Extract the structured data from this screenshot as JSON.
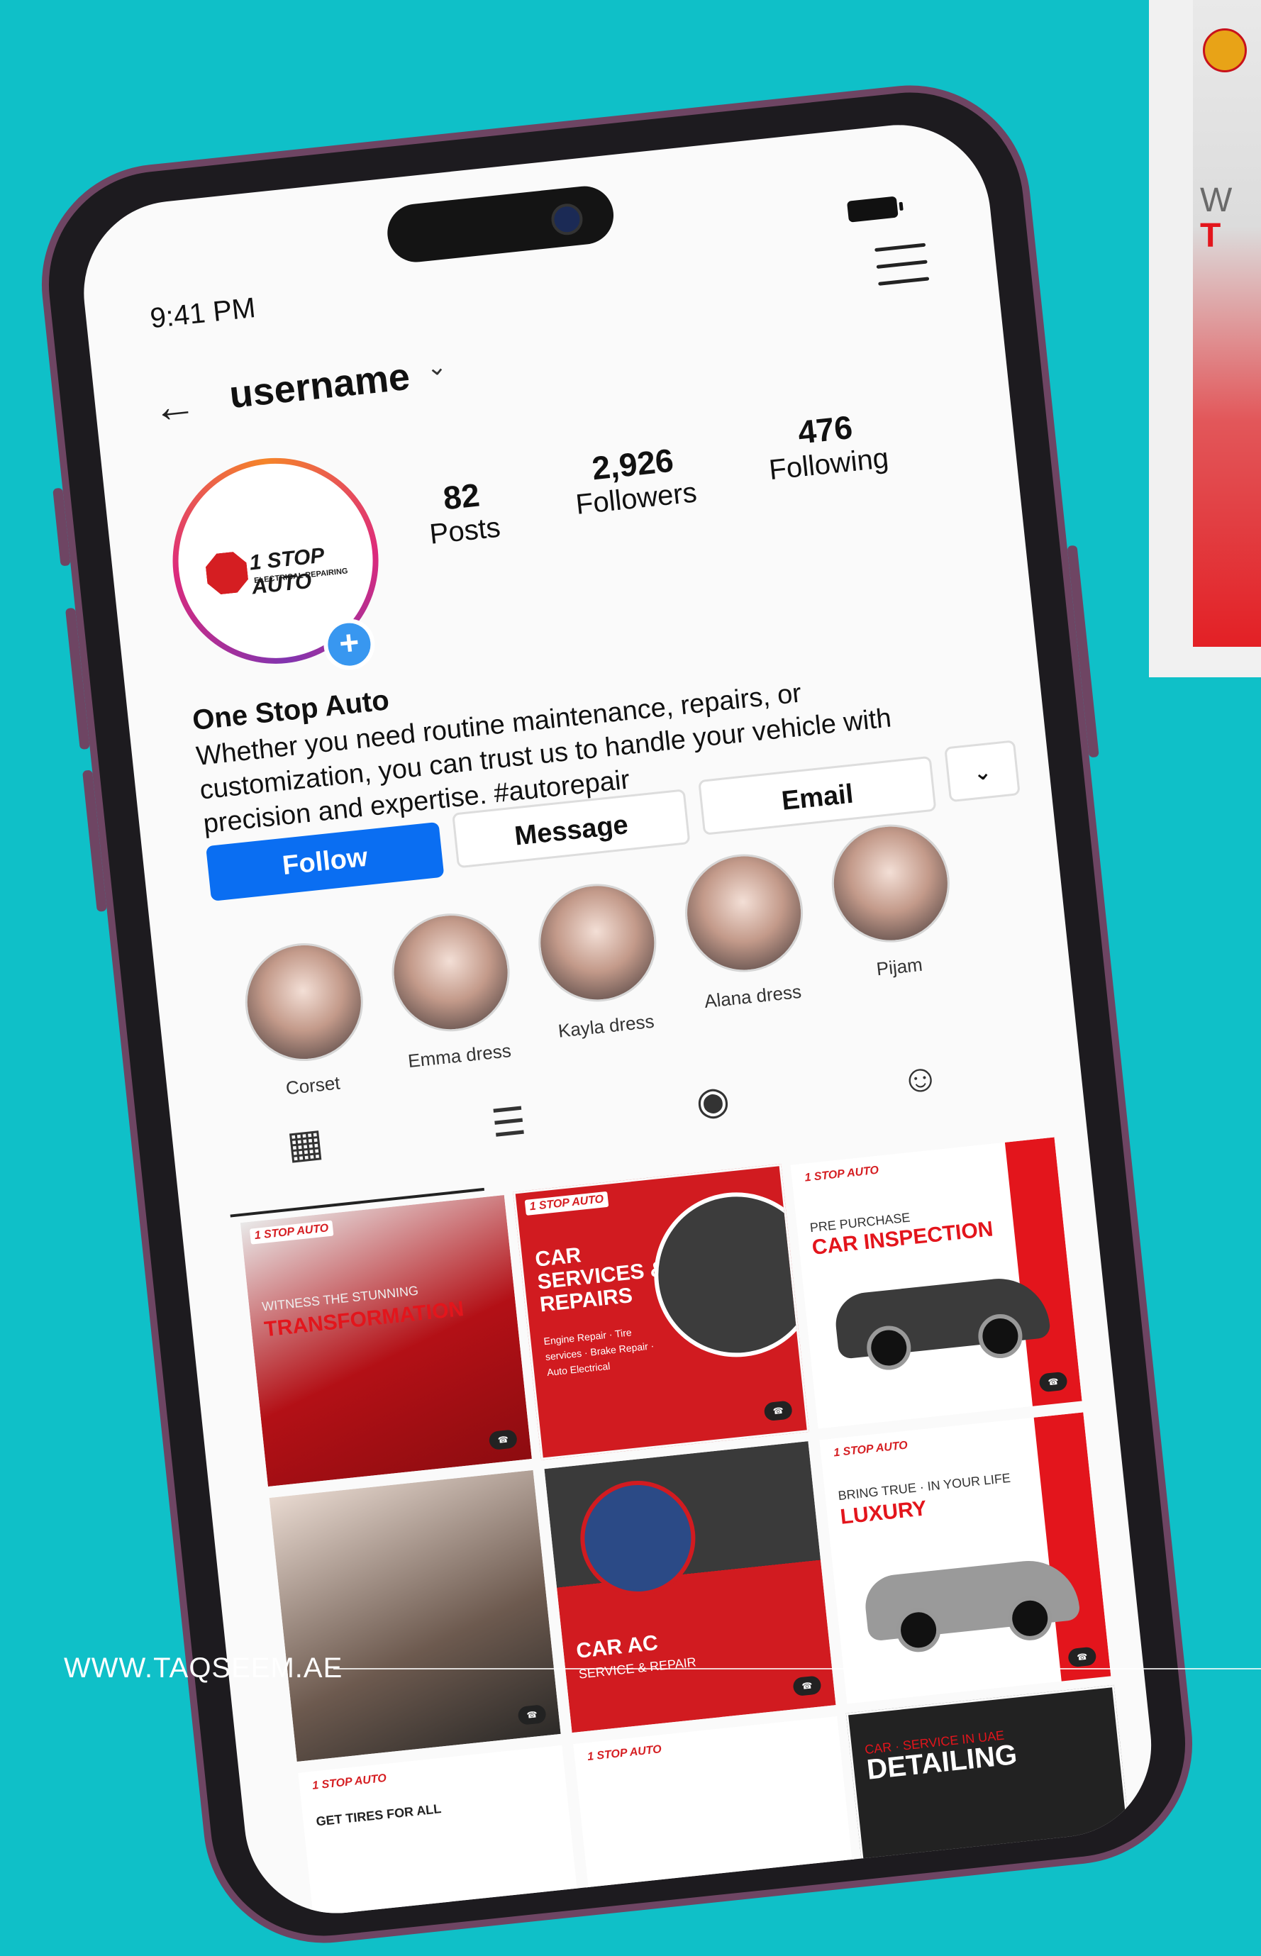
{
  "status": {
    "time": "9:41 PM"
  },
  "profile": {
    "username": "username",
    "stats": [
      {
        "value": "82",
        "label": "Posts"
      },
      {
        "value": "2,926",
        "label": "Followers"
      },
      {
        "value": "476",
        "label": "Following"
      }
    ],
    "name": "One Stop Auto",
    "bio": "Whether you need routine maintenance, repairs, or customization,  you can trust us to handle your vehicle with precision and expertise. #autorepair",
    "logo": {
      "main": "1 STOP AUTO",
      "sub": "ELECTRICAL REPAIRING"
    }
  },
  "actions": {
    "follow": "Follow",
    "message": "Message",
    "email": "Email"
  },
  "highlights": [
    {
      "label": "Corset"
    },
    {
      "label": "Emma dress"
    },
    {
      "label": "Kayla dress"
    },
    {
      "label": "Alana dress"
    },
    {
      "label": "Pijam"
    }
  ],
  "tabs": [
    "grid-icon",
    "list-icon",
    "location-pin-icon",
    "tagged-user-icon"
  ],
  "posts": [
    {
      "title": "TRANSFORMATION",
      "subtitle": "WITNESS THE STUNNING",
      "bg": "#c8161c"
    },
    {
      "title": "CAR SERVICES & REPAIRS",
      "subtitle": "Engine Repair · Tire services · Brake Repair · Auto Electrical",
      "bg": "#d11b20"
    },
    {
      "title": "CAR INSPECTION",
      "subtitle": "PRE PURCHASE",
      "bg": "#ffffff"
    },
    {
      "title": "",
      "subtitle": "",
      "bg": "#4a3a34"
    },
    {
      "title": "CAR AC",
      "subtitle": "SERVICE & REPAIR",
      "bg": "#d11b20"
    },
    {
      "title": "LUXURY",
      "subtitle": "BRING TRUE · IN YOUR LIFE",
      "bg": "#ffffff"
    },
    {
      "title": "GET TIRES FOR ALL",
      "subtitle": "",
      "bg": "#ffffff"
    },
    {
      "title": "",
      "subtitle": "",
      "bg": "#ffffff"
    },
    {
      "title": "DETAILING",
      "subtitle": "CAR · SERVICE IN UAE",
      "bg": "#222222"
    }
  ],
  "promo": {
    "line1": "W",
    "line2": "T"
  },
  "footer": {
    "url": "WWW.TAQSEEM.AE"
  },
  "colors": {
    "background": "#0fc0c8",
    "follow": "#0a6ef2",
    "brand_red": "#d51e22",
    "phone_frame": "#6e4563"
  }
}
